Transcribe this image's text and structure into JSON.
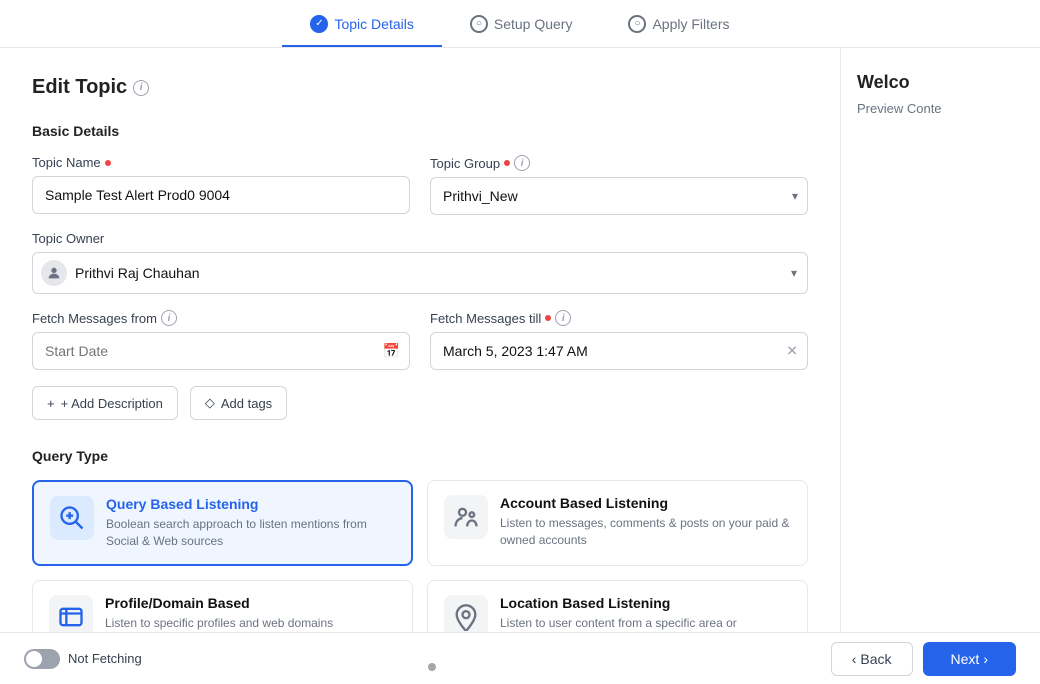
{
  "nav": {
    "steps": [
      {
        "id": "topic-details",
        "label": "Topic Details",
        "active": true
      },
      {
        "id": "setup-query",
        "label": "Setup Query",
        "active": false
      },
      {
        "id": "apply-filters",
        "label": "Apply Filters",
        "active": false
      }
    ]
  },
  "page": {
    "title": "Edit Topic",
    "info_icon": "i"
  },
  "basic_details": {
    "section_title": "Basic Details",
    "topic_name_label": "Topic Name",
    "topic_name_value": "Sample Test Alert Prod0 9004",
    "topic_name_placeholder": "Topic Name",
    "topic_group_label": "Topic Group",
    "topic_group_value": "Prithvi_New",
    "topic_owner_label": "Topic Owner",
    "topic_owner_value": "Prithvi Raj Chauhan",
    "fetch_from_label": "Fetch Messages from",
    "fetch_from_placeholder": "Start Date",
    "fetch_till_label": "Fetch Messages till",
    "fetch_till_value": "March 5, 2023 1:47 AM"
  },
  "actions": {
    "add_description_label": "+ Add Description",
    "add_tags_label": "Add tags"
  },
  "query_type": {
    "section_title": "Query Type",
    "cards": [
      {
        "id": "query-based",
        "title": "Query Based Listening",
        "description": "Boolean search approach to listen mentions from Social & Web sources",
        "active": true,
        "icon": "🔍"
      },
      {
        "id": "account-based",
        "title": "Account Based Listening",
        "description": "Listen to messages, comments & posts on your paid & owned accounts",
        "active": false,
        "icon": "👤"
      },
      {
        "id": "profile-domain",
        "title": "Profile/Domain Based",
        "description": "Listen to specific profiles and web domains",
        "active": false,
        "icon": "🌐"
      },
      {
        "id": "location-based",
        "title": "Location Based Listening",
        "description": "Listen to user content from a specific area or",
        "active": false,
        "icon": "📍"
      }
    ]
  },
  "right_panel": {
    "title": "Welco",
    "subtitle": "Preview Conte"
  },
  "bottom_bar": {
    "toggle_label": "Not Fetching",
    "back_label": "Back",
    "next_label": "Next"
  }
}
